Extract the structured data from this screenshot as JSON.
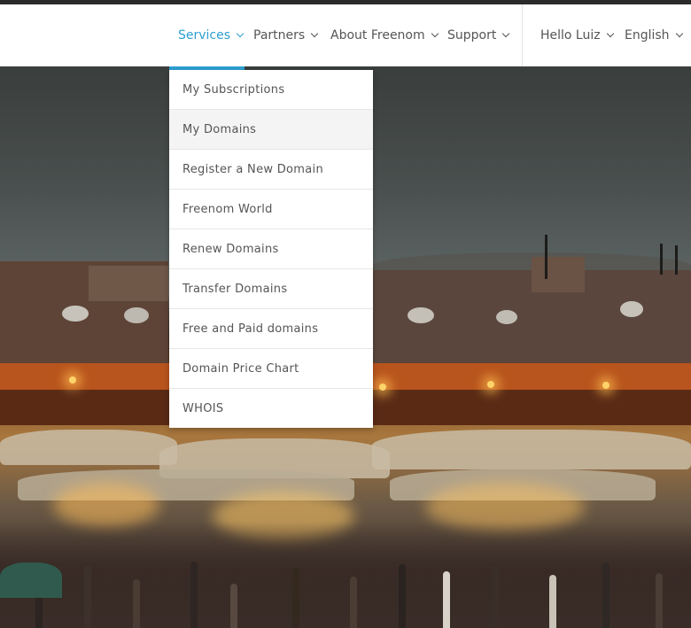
{
  "nav": {
    "items": [
      {
        "label": "Services",
        "active": true
      },
      {
        "label": "Partners"
      },
      {
        "label": "About Freenom"
      },
      {
        "label": "Support"
      }
    ],
    "user": {
      "label": "Hello Luiz"
    },
    "language": {
      "label": "English"
    }
  },
  "dropdown": {
    "items": [
      {
        "label": "My Subscriptions"
      },
      {
        "label": "My Domains",
        "highlighted": true
      },
      {
        "label": "Register a New Domain"
      },
      {
        "label": "Freenom World"
      },
      {
        "label": "Renew Domains"
      },
      {
        "label": "Transfer Domains"
      },
      {
        "label": "Free and Paid domains"
      },
      {
        "label": "Domain Price Chart"
      },
      {
        "label": "WHOIS"
      }
    ]
  },
  "colors": {
    "accent": "#2e9fd1",
    "nav_text": "#555555",
    "dropdown_bg": "#ffffff"
  },
  "icons": {
    "chevron": "chevron-down-icon"
  }
}
